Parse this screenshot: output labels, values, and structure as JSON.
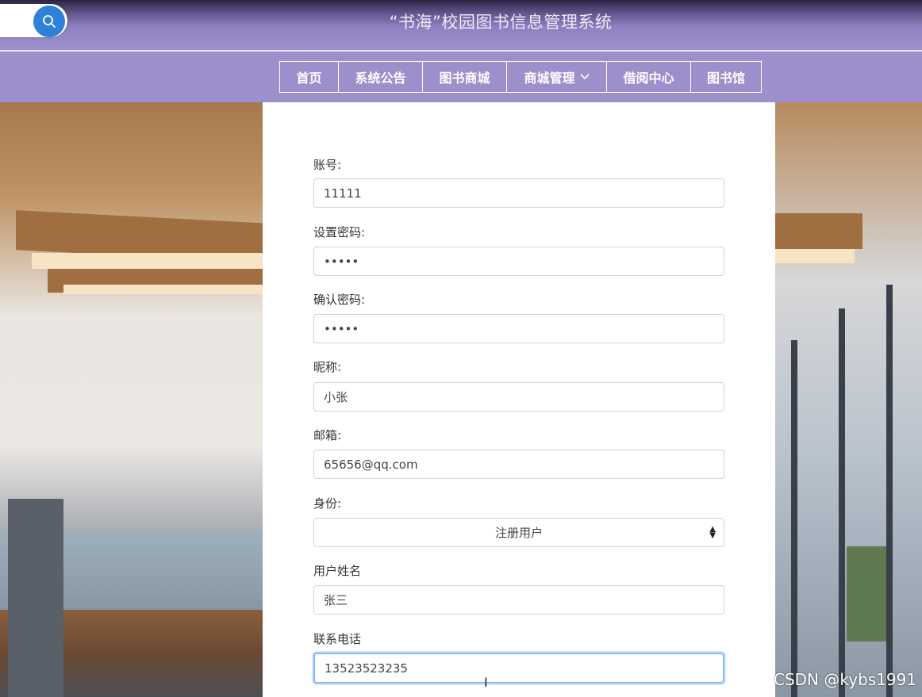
{
  "header": {
    "title": "“书海”校园图书信息管理系统",
    "search_icon": "search-icon"
  },
  "nav": {
    "items": [
      {
        "label": "首页"
      },
      {
        "label": "系统公告"
      },
      {
        "label": "图书商城"
      },
      {
        "label": "商城管理",
        "icon": "chevron-down-icon"
      },
      {
        "label": "借阅中心"
      },
      {
        "label": "图书馆"
      }
    ]
  },
  "form": {
    "account_label": "账号:",
    "account_value": "11111",
    "password_label": "设置密码:",
    "password_value": "•••••",
    "confirm_label": "确认密码:",
    "confirm_value": "•••••",
    "nickname_label": "昵称:",
    "nickname_value": "小张",
    "email_label": "邮箱:",
    "email_value": "65656@qq.com",
    "role_label": "身份:",
    "role_value": "注册用户",
    "realname_label": "用户姓名",
    "realname_value": "张三",
    "phone_label": "联系电话",
    "phone_value": "13523523235"
  },
  "watermark": "CSDN @kybs1991",
  "colors": {
    "header_purple": "#9d8fcb",
    "search_blue": "#2f80d8",
    "focus_blue": "#86b7fe"
  }
}
